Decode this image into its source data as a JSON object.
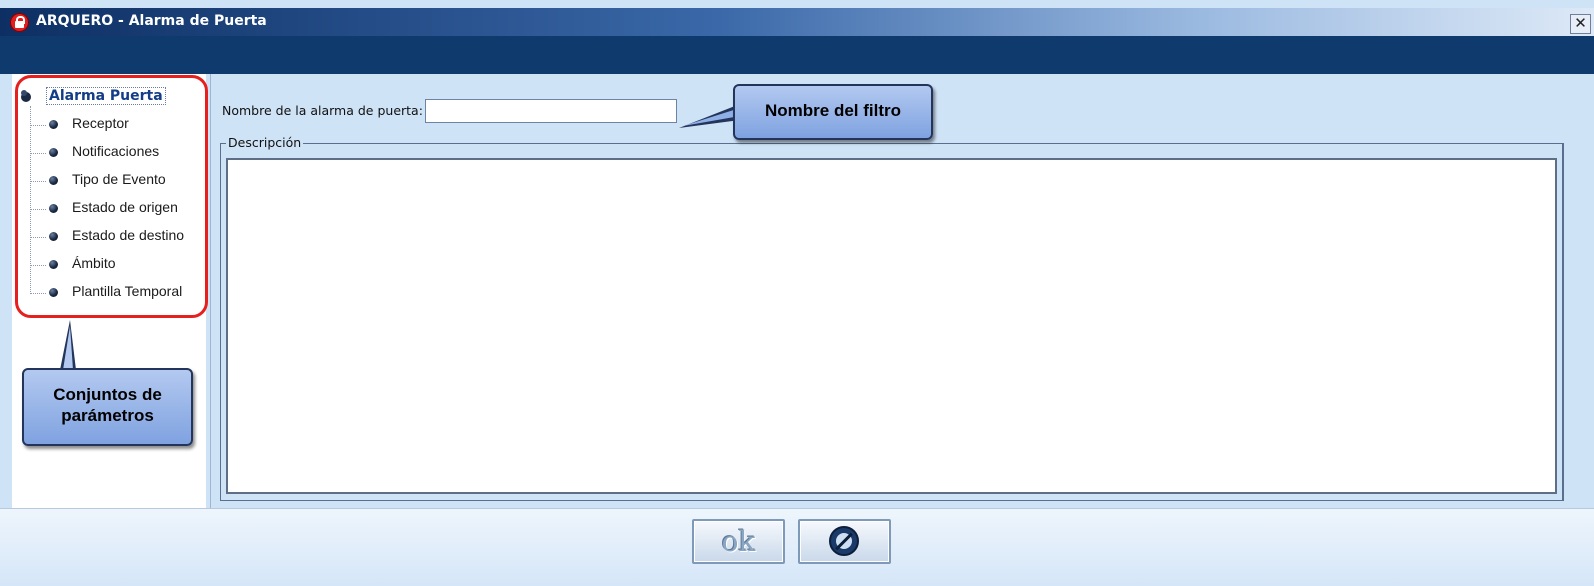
{
  "window": {
    "title": "ARQUERO - Alarma de Puerta",
    "close_label": "✕"
  },
  "tree": {
    "root_label": "Alarma Puerta",
    "items": [
      {
        "label": "Receptor"
      },
      {
        "label": "Notificaciones"
      },
      {
        "label": "Tipo de Evento"
      },
      {
        "label": "Estado de origen"
      },
      {
        "label": "Estado de destino"
      },
      {
        "label": "Ámbito"
      },
      {
        "label": "Plantilla Temporal"
      }
    ]
  },
  "form": {
    "name_label": "Nombre de la alarma de puerta:",
    "name_value": "",
    "description_legend": "Descripción",
    "description_value": ""
  },
  "buttons": {
    "ok_label": "ok"
  },
  "callouts": {
    "filter_name": "Nombre del filtro",
    "param_sets_line1": "Conjuntos de",
    "param_sets_line2": "parámetros"
  },
  "colors": {
    "title_bar_dark": "#0d2f63",
    "nav_band": "#0f3a6d",
    "panel_bg": "#cfe3f7",
    "highlight_red": "#e61f1f",
    "callout_blue": "#9bb8ea"
  }
}
